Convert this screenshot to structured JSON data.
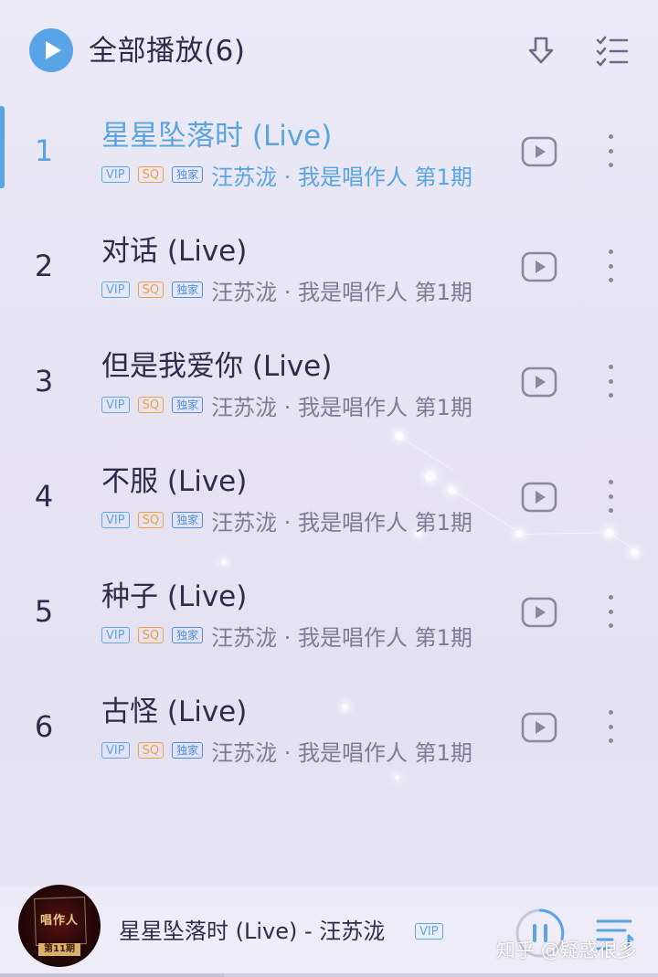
{
  "header": {
    "play_all_label": "全部播放(6)",
    "download_icon": "download-icon",
    "multiselect_icon": "multi-select-icon"
  },
  "songs": [
    {
      "index": "1",
      "title": "星星坠落时 (Live)",
      "tags": [
        "VIP",
        "SQ",
        "独家"
      ],
      "subtitle": "汪苏泷 · 我是唱作人 第1期",
      "active": true
    },
    {
      "index": "2",
      "title": "对话 (Live)",
      "tags": [
        "VIP",
        "SQ",
        "独家"
      ],
      "subtitle": "汪苏泷 · 我是唱作人 第1期",
      "active": false
    },
    {
      "index": "3",
      "title": "但是我爱你 (Live)",
      "tags": [
        "VIP",
        "SQ",
        "独家"
      ],
      "subtitle": "汪苏泷 · 我是唱作人 第1期",
      "active": false
    },
    {
      "index": "4",
      "title": "不服 (Live)",
      "tags": [
        "VIP",
        "SQ",
        "独家"
      ],
      "subtitle": "汪苏泷 · 我是唱作人 第1期",
      "active": false
    },
    {
      "index": "5",
      "title": "种子 (Live)",
      "tags": [
        "VIP",
        "SQ",
        "独家"
      ],
      "subtitle": "汪苏泷 · 我是唱作人 第1期",
      "active": false
    },
    {
      "index": "6",
      "title": "古怪 (Live)",
      "tags": [
        "VIP",
        "SQ",
        "独家"
      ],
      "subtitle": "汪苏泷 · 我是唱作人 第1期",
      "active": false
    }
  ],
  "player": {
    "now_playing": "星星坠落时 (Live) - 汪苏泷",
    "vip_tag": "VIP",
    "cover_title": "唱作人",
    "cover_badge": "第11期",
    "progress": 0.34
  },
  "watermark": "知乎 @疑惑很多",
  "colors": {
    "accent": "#58a4e6",
    "vip": "#5ba9e3",
    "sq": "#f0a23a",
    "text": "#2e2c4a",
    "subtext": "#7e7b96"
  }
}
